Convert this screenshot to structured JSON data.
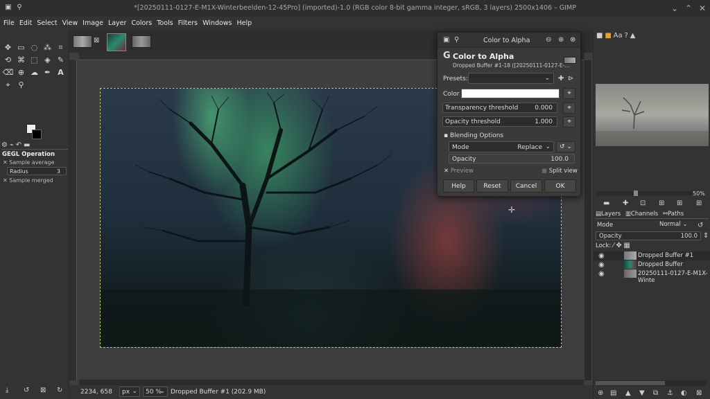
{
  "window": {
    "title": "*[20250111-0127-E-M1X-Winterbeelden-12-45Pro] (imported)-1.0 (RGB color 8-bit gamma integer, sRGB, 3 layers) 2500x1406 – GIMP"
  },
  "menu": [
    "File",
    "Edit",
    "Select",
    "View",
    "Image",
    "Layer",
    "Colors",
    "Tools",
    "Filters",
    "Windows",
    "Help"
  ],
  "toolbox": {
    "tab_labels": [
      "GEGL Operation"
    ],
    "sample_average": "Sample average",
    "radius_label": "Radius",
    "radius_value": "3",
    "sample_merged": "Sample merged"
  },
  "status": {
    "coords": "2234, 658",
    "unit": "px",
    "zoom": "50 %",
    "message": "Dropped Buffer #1 (202.9 MB)"
  },
  "dialog": {
    "window_title": "Color to Alpha",
    "heading": "Color to Alpha",
    "subheading": "Dropped Buffer #1-18 ([20250111-0127-E-...",
    "presets_label": "Presets:",
    "color_label": "Color",
    "transparency_label": "Transparency threshold",
    "transparency_value": "0.000",
    "opacity_threshold_label": "Opacity threshold",
    "opacity_threshold_value": "1.000",
    "blending_label": "Blending Options",
    "mode_label": "Mode",
    "mode_value": "Replace",
    "opacity_label": "Opacity",
    "opacity_value": "100.0",
    "preview_label": "Preview",
    "split_label": "Split view",
    "buttons": {
      "help": "Help",
      "reset": "Reset",
      "cancel": "Cancel",
      "ok": "OK"
    }
  },
  "navigator": {
    "zoom": "50%"
  },
  "layers": {
    "tabs": [
      "Layers",
      "Channels",
      "Paths"
    ],
    "mode_label": "Mode",
    "mode_value": "Normal",
    "opacity_label": "Opacity",
    "opacity_value": "100.0",
    "lock_label": "Lock:",
    "items": [
      {
        "name": "Dropped Buffer #1"
      },
      {
        "name": "Dropped Buffer"
      },
      {
        "name": "20250111-0127-E-M1X-Winte"
      }
    ]
  }
}
